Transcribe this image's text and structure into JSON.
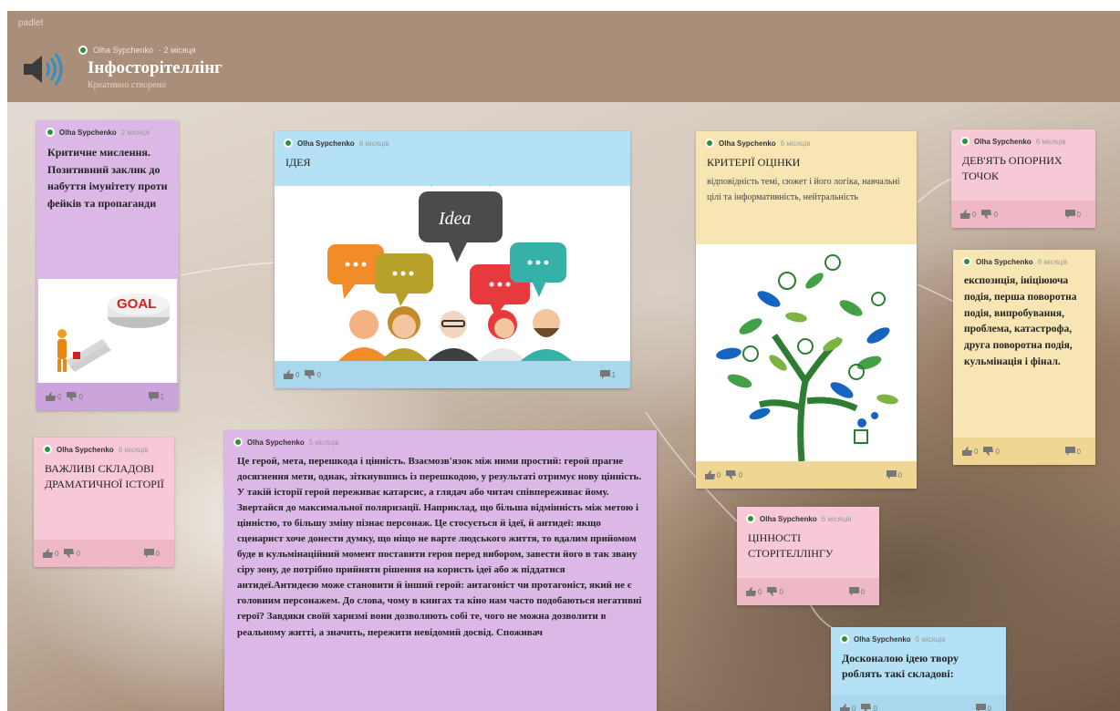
{
  "app": {
    "brand": "padlet"
  },
  "header": {
    "author": "Olha Sypchenko",
    "time": "· 2 місяця",
    "title": "Інфосторітеллінг",
    "subtitle": "Креативно створено"
  },
  "posts": {
    "critical": {
      "author": "Olha Sypchenko",
      "time": "2 місяця",
      "title": "Критичне мислення. Позитивний заклик до набуття імунітету проти фейків та пропаганди",
      "image_text": "GOAL",
      "likes": "0",
      "dislikes": "0",
      "comments": "1"
    },
    "idea": {
      "author": "Olha Sypchenko",
      "time": "6 місяців",
      "title": "ІДЕЯ",
      "image_text": "Idea",
      "likes": "0",
      "dislikes": "0",
      "comments": "1"
    },
    "criteria": {
      "author": "Olha Sypchenko",
      "time": "6 місяців",
      "title": "КРИТЕРІЇ ОЦІНКИ",
      "body": "відповідність темі, сюжет і його логіка, навчальні цілі та інформативність, нейтральність",
      "likes": "0",
      "dislikes": "0",
      "comments": "0"
    },
    "nine_points": {
      "author": "Olha Sypchenko",
      "time": "6 місяців",
      "title": "ДЕВ'ЯТЬ ОПОРНИХ ТОЧОК",
      "likes": "0",
      "dislikes": "0",
      "comments": "0"
    },
    "exposition": {
      "author": "Olha Sypchenko",
      "time": "6 місяців",
      "title": "експозиція, ініціююча подія, перша поворотна подія, випробування, проблема, катастрофа, друга поворотна подія, кульмінація і фінал.",
      "likes": "0",
      "dislikes": "0",
      "comments": "0"
    },
    "components": {
      "author": "Olha Sypchenko",
      "time": "6 місяців",
      "title": "ВАЖЛИВІ СКЛАДОВІ ДРАМАТИЧНОЇ ІСТОРІЇ",
      "likes": "0",
      "dislikes": "0",
      "comments": "0"
    },
    "hero": {
      "author": "Olha Sypchenko",
      "time": "5 місяців",
      "text": "Це герой, мета, перешкода і цінність. Взаємозв'язок між ними простий: герой прагне досягнення мети, однак, зіткнувшись із перешкодою, у результаті отримує нову цінність. У такій історії герой переживає катарсис, а глядач або читач співпереживає йому. Звертайся до максимальної поляризації. Наприклад, що більша відмінність між метою і цінністю, то більшу зміну пізнає персонаж. Це стосується й ідеї, й антидеї: якщо сценарист хоче донести думку, що ніщо не варте людського життя, то вдалим прийомом буде в кульмінаційний момент поставити героя перед вибором, завести його в так звану сіру зону, де потрібно прийняти рішення на користь ідеї або ж піддатися антидеї.Антидеєю може становити й інший герой: антагоніст чи протагоніст, який не є головним персонажем. До слова, чому в книгах та кіно нам часто подобаються негативні герої? Завдяки своїй харизмі вони дозволяють собі те, чого не можна дозволити в реальному житті, а значить, пережити невідомий досвід. Споживач"
    },
    "values": {
      "author": "Olha Sypchenko",
      "time": "6 місяців",
      "title": "ЦІННОСТІ СТОРІТЕЛЛІНГУ",
      "likes": "0",
      "dislikes": "0",
      "comments": "0"
    },
    "perfect": {
      "author": "Olha Sypchenko",
      "time": "5 місяців",
      "title": "Досконалою ідею твору роблять такі складові:",
      "likes": "0",
      "dislikes": "0",
      "comments": "0"
    }
  },
  "colors": {
    "header": "#a98e7a",
    "purple": "#dbb8e6",
    "blue": "#b5e1f6",
    "yellow": "#f7e6b4",
    "pink": "#f7c9d6",
    "avatar": "#2f8f3a"
  },
  "icons": [
    "speaker-icon",
    "avatar-dot",
    "thumbs-up-icon",
    "thumbs-down-icon",
    "comment-icon"
  ]
}
